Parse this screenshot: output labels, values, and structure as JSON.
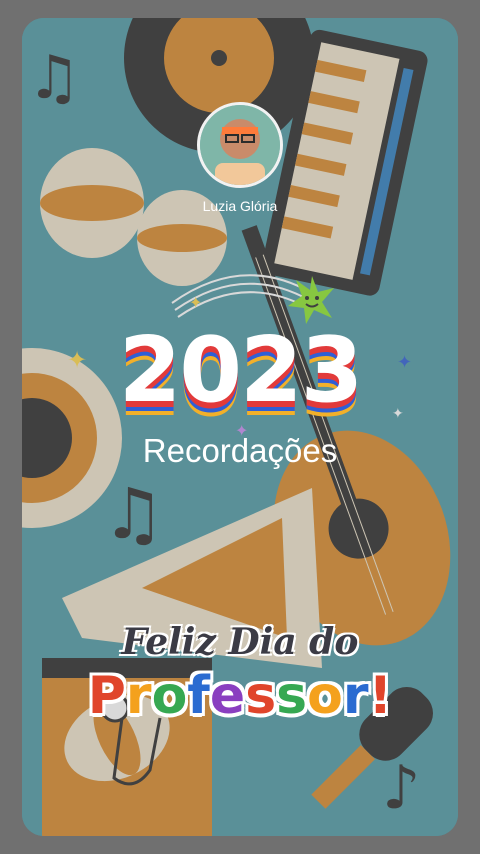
{
  "story": {
    "profile_name": "Luzia Glória",
    "year": "2023",
    "subtitle": "Recordações",
    "sticker": {
      "line1": "Feliz Dia do",
      "line2_letters": [
        "P",
        "r",
        "o",
        "f",
        "e",
        "s",
        "s",
        "o",
        "r",
        "!"
      ],
      "line2_colors": [
        "#e0452b",
        "#f4a11d",
        "#36a852",
        "#2a6bd1",
        "#8a3fc0",
        "#e0452b",
        "#36a852",
        "#f4a11d",
        "#2a6bd1",
        "#e0452b"
      ]
    }
  },
  "colors": {
    "background": "#4f9aa6",
    "accent_orange": "#d98a2b",
    "dark": "#2b2b2b",
    "cream": "#efe4cc"
  }
}
